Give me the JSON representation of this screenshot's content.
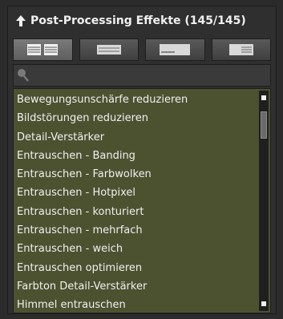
{
  "panel": {
    "title": "Post-Processing Effekte (145/145)"
  },
  "view_buttons": [
    {
      "icon": "grid-view-icon"
    },
    {
      "icon": "list-view-icon"
    },
    {
      "icon": "compact-view-icon"
    },
    {
      "icon": "detail-view-icon"
    }
  ],
  "search": {
    "value": "",
    "placeholder": ""
  },
  "effects": [
    "Bewegungsunschärfe reduzieren",
    "Bildstörungen reduzieren",
    "Detail-Verstärker",
    "Entrauschen - Banding",
    "Entrauschen - Farbwolken",
    "Entrauschen - Hotpixel",
    "Entrauschen - konturiert",
    "Entrauschen - mehrfach",
    "Entrauschen - weich",
    "Entrauschen optimieren",
    "Farbton Detail-Verstärker",
    "Himmel entrauschen"
  ],
  "colors": {
    "list_bg": "#4c5230",
    "panel_bg": "#2f2f2f"
  }
}
